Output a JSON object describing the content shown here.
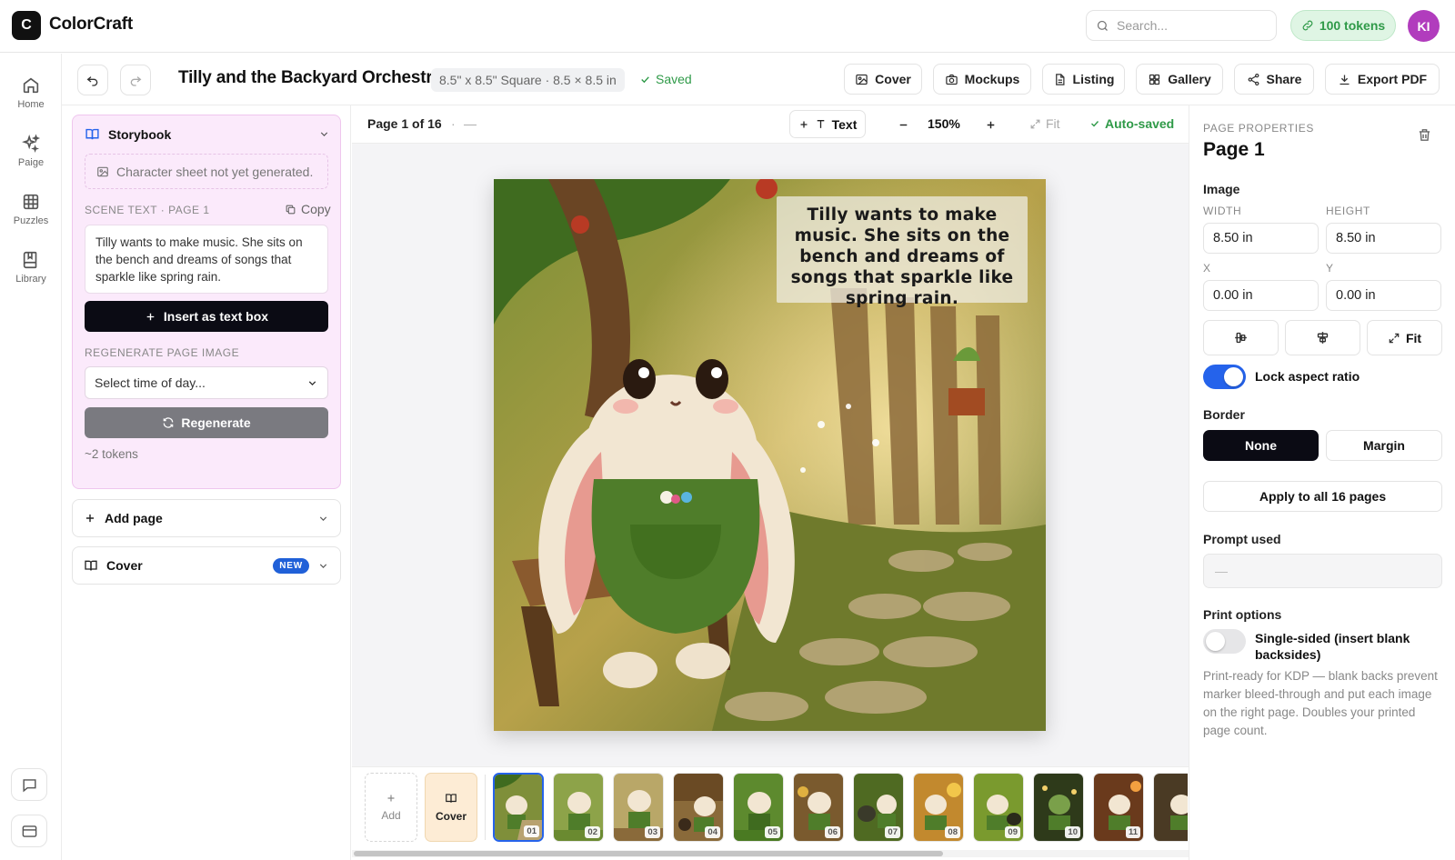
{
  "app": {
    "logo_letter": "C",
    "name": "ColorCraft"
  },
  "topbar": {
    "search_placeholder": "Search...",
    "tokens_label": "100 tokens",
    "avatar_initials": "KI"
  },
  "nav": [
    {
      "label": "Home",
      "icon": "home-icon"
    },
    {
      "label": "Paige",
      "icon": "sparkles-icon"
    },
    {
      "label": "Puzzles",
      "icon": "grid-icon"
    },
    {
      "label": "Library",
      "icon": "book-icon"
    }
  ],
  "nav_bottom": [
    {
      "icon": "chat-icon"
    },
    {
      "icon": "card-icon"
    }
  ],
  "toolbar": {
    "title": "Tilly and the Backyard Orchestra",
    "size": "8.5\" x 8.5\" Square · 8.5 × 8.5 in",
    "saved": "Saved",
    "buttons": [
      {
        "label": "Cover",
        "icon": "image-icon"
      },
      {
        "label": "Mockups",
        "icon": "camera-icon"
      },
      {
        "label": "Listing",
        "icon": "document-icon"
      },
      {
        "label": "Gallery",
        "icon": "grid-icon"
      },
      {
        "label": "Share",
        "icon": "share-icon"
      },
      {
        "label": "Export PDF",
        "icon": "download-icon"
      }
    ]
  },
  "storybook": {
    "title": "Storybook",
    "character_sheet": "Character sheet not yet generated.",
    "scene_label": "SCENE TEXT · PAGE 1",
    "copy_label": "Copy",
    "scene_text": "Tilly wants to make music. She sits on the bench and dreams of songs that sparkle like spring rain.",
    "insert_label": "Insert as text box",
    "regen_label": "REGENERATE PAGE IMAGE",
    "select_placeholder": "Select time of day...",
    "regenerate_button": "Regenerate",
    "token_note": "~2 tokens"
  },
  "accordions": [
    {
      "label": "Add page",
      "icon": "plus-icon"
    },
    {
      "label": "Cover",
      "icon": "book-icon",
      "badge": "NEW"
    }
  ],
  "canvas": {
    "page_indicator": "Page 1 of 16",
    "dash": "—",
    "text_button": "Text",
    "zoom": "150%",
    "fit": "Fit",
    "autosaved": "Auto-saved",
    "page_text": "Tilly wants to make music. She sits on the bench and dreams of songs that sparkle like spring rain."
  },
  "filmstrip": {
    "add_label": "Add",
    "cover_label": "Cover",
    "thumbs": [
      "01",
      "02",
      "03",
      "04",
      "05",
      "06",
      "07",
      "08",
      "09",
      "10",
      "11"
    ]
  },
  "properties": {
    "caption": "PAGE PROPERTIES",
    "title": "Page 1",
    "image_heading": "Image",
    "width_label": "WIDTH",
    "height_label": "HEIGHT",
    "width_value": "8.50 in",
    "height_value": "8.50 in",
    "x_label": "X",
    "y_label": "Y",
    "x_value": "0.00 in",
    "y_value": "0.00 in",
    "fit_label": "Fit",
    "lock_label": "Lock aspect ratio",
    "lock_on": true,
    "border_heading": "Border",
    "border_none": "None",
    "border_margin": "Margin",
    "apply_all": "Apply to all 16 pages",
    "prompt_heading": "Prompt used",
    "prompt_value": "—",
    "print_heading": "Print options",
    "single_sided": "Single-sided (insert blank backsides)",
    "single_sided_on": false,
    "print_note": "Print-ready for KDP — blank backs prevent marker bleed-through and put each image on the right page. Doubles your printed page count."
  },
  "colors": {
    "accent_green": "#2f9a48",
    "avatar": "#b13cbd",
    "toggle_on": "#2563eb",
    "badge_blue": "#2060d8",
    "storybook_bg": "#fbeafb"
  }
}
